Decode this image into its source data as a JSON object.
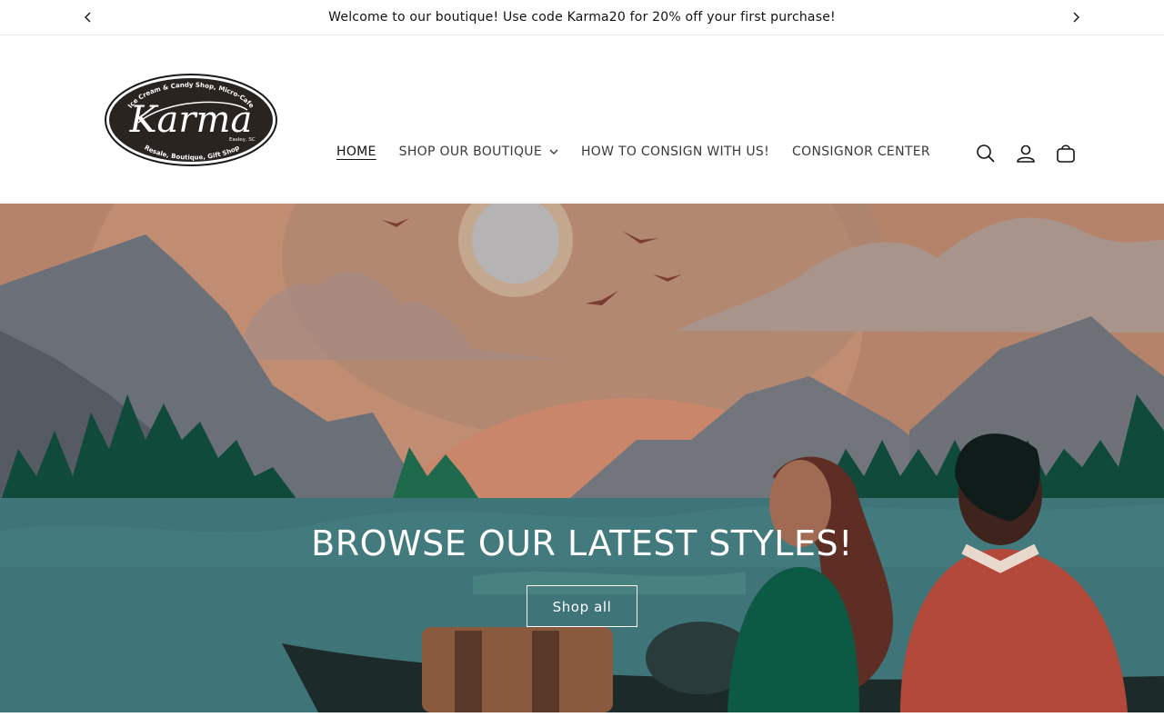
{
  "announcement": {
    "text": "Welcome to our boutique! Use code Karma20 for 20% off your first purchase!",
    "prev_icon": "chevron-left-icon",
    "next_icon": "chevron-right-icon"
  },
  "logo": {
    "top_text": "Ice Cream & Candy Shop, Micro-Cafe",
    "brand": "Karma",
    "location": "Easley, SC",
    "bottom_text": "Resale, Boutique, Gift Shop"
  },
  "nav": {
    "items": [
      {
        "label": "HOME",
        "active": true
      },
      {
        "label": "SHOP OUR BOUTIQUE",
        "has_dropdown": true
      },
      {
        "label": "HOW TO CONSIGN WITH US!"
      },
      {
        "label": "CONSIGNOR CENTER"
      }
    ]
  },
  "header_icons": [
    "search-icon",
    "account-icon",
    "cart-icon"
  ],
  "hero": {
    "title": "BROWSE OUR LATEST STYLES!",
    "button_label": "Shop all"
  },
  "colors": {
    "sky": "#b98a6c",
    "water": "#3f7479",
    "white": "#ffffff"
  }
}
